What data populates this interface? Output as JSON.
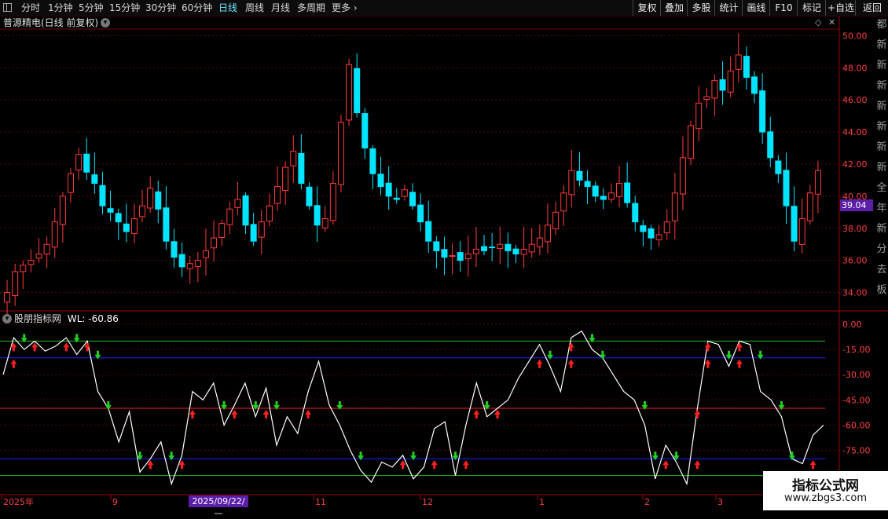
{
  "toolbar": {
    "periods": [
      "分时",
      "1分钟",
      "5分钟",
      "15分钟",
      "30分钟",
      "60分钟",
      "日线",
      "周线",
      "月线",
      "多周期",
      "更多"
    ],
    "active_period": "日线",
    "right_buttons": [
      "复权",
      "叠加",
      "多股",
      "统计",
      "画线",
      "F10",
      "标记",
      "+自选",
      "返回"
    ]
  },
  "main_chart": {
    "title": "普源精电(日线 前复权)",
    "y_labels": [
      "50.00",
      "48.00",
      "46.00",
      "44.00",
      "42.00",
      "40.00",
      "38.00",
      "36.00",
      "34.00"
    ],
    "current_price": "39.04"
  },
  "indicator": {
    "title": "股朋指标网",
    "value_label": "WL: -60.86",
    "y_labels": [
      "0.00",
      "-15.00",
      "-30.00",
      "-45.00",
      "-60.00",
      "-75.00"
    ]
  },
  "x_axis": {
    "labels": [
      "2025年",
      "9",
      "11",
      "12",
      "1",
      "2",
      "3"
    ],
    "cursor_date": "2025/09/22/—"
  },
  "right_strip_chars": [
    "都",
    "新",
    "新",
    "新",
    "新",
    "新",
    "新",
    "新",
    "全",
    "年",
    "新",
    "分",
    "去",
    "板"
  ],
  "watermark": {
    "line1": "指标公式网",
    "line2": "www.zbgs3.com"
  },
  "colors": {
    "up": "#ff3b3b",
    "down": "#00e5ff",
    "buy_arrow": "#ff2020",
    "sell_arrow": "#20d020",
    "grid": "#5a0000",
    "line": "#ffffff"
  },
  "chart_data": [
    {
      "type": "candlestick",
      "title": "普源精电(日线 前复权)",
      "ylim": [
        33,
        51
      ],
      "closes": [
        34.0,
        35.3,
        35.7,
        36.0,
        36.4,
        37.0,
        38.4,
        40.0,
        41.4,
        42.6,
        41.5,
        40.8,
        39.4,
        39.0,
        38.4,
        37.8,
        38.6,
        39.4,
        40.5,
        39.2,
        37.2,
        36.2,
        35.6,
        35.8,
        36.0,
        36.6,
        37.4,
        38.3,
        39.2,
        39.8,
        38.2,
        37.2,
        38.4,
        39.4,
        40.6,
        41.8,
        42.8,
        40.8,
        39.4,
        38.2,
        38.6,
        40.8,
        44.6,
        48.2,
        45.2,
        43.0,
        41.4,
        40.6,
        40.0,
        39.8,
        40.4,
        39.4,
        38.4,
        37.2,
        36.6,
        36.2,
        36.3,
        36.0,
        36.4,
        36.7,
        36.6,
        36.8,
        37.0,
        36.6,
        36.4,
        36.7,
        37.0,
        37.4,
        38.2,
        39.0,
        40.2,
        41.6,
        41.0,
        40.6,
        40.0,
        39.8,
        40.2,
        40.8,
        39.6,
        38.4,
        37.8,
        37.4,
        37.6,
        38.4,
        40.2,
        42.4,
        44.4,
        45.8,
        46.2,
        47.2,
        46.6,
        47.8,
        48.8,
        47.4,
        46.4,
        44.0,
        42.4,
        41.4,
        39.4,
        37.2,
        38.6,
        40.2,
        41.6
      ]
    },
    {
      "type": "line",
      "title": "股朋指标网",
      "series": [
        {
          "name": "WL",
          "values": [
            -30,
            -8,
            -15,
            -10,
            -16,
            -13,
            -8,
            -18,
            -10,
            -40,
            -50,
            -70,
            -52,
            -88,
            -80,
            -70,
            -95,
            -78,
            -40,
            -45,
            -35,
            -60,
            -48,
            -35,
            -55,
            -38,
            -72,
            -55,
            -65,
            -40,
            -22,
            -48,
            -60,
            -75,
            -87,
            -94,
            -82,
            -85,
            -78,
            -92,
            -85,
            -62,
            -58,
            -90,
            -60,
            -35,
            -55,
            -50,
            -45,
            -32,
            -22,
            -12,
            -25,
            -40,
            -8,
            -4,
            -15,
            -20,
            -30,
            -40,
            -45,
            -60,
            -92,
            -72,
            -82,
            -95,
            -50,
            -10,
            -12,
            -25,
            -10,
            -12,
            -40,
            -45,
            -55,
            -80,
            -83,
            -66,
            -60
          ]
        }
      ],
      "ylim": [
        -100,
        0
      ]
    }
  ]
}
